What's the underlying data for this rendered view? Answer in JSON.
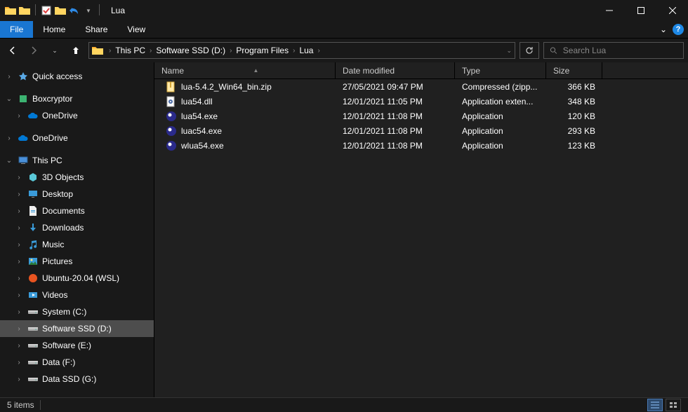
{
  "window": {
    "title": "Lua"
  },
  "ribbon": {
    "file": "File",
    "home": "Home",
    "share": "Share",
    "view": "View"
  },
  "breadcrumb": {
    "items": [
      "This PC",
      "Software SSD (D:)",
      "Program Files",
      "Lua"
    ]
  },
  "search": {
    "placeholder": "Search Lua"
  },
  "columns": {
    "name": "Name",
    "date": "Date modified",
    "type": "Type",
    "size": "Size"
  },
  "files": [
    {
      "name": "lua-5.4.2_Win64_bin.zip",
      "date": "27/05/2021 09:47 PM",
      "type": "Compressed (zipp...",
      "size": "366 KB",
      "icon": "zip"
    },
    {
      "name": "lua54.dll",
      "date": "12/01/2021 11:05 PM",
      "type": "Application exten...",
      "size": "348 KB",
      "icon": "dll"
    },
    {
      "name": "lua54.exe",
      "date": "12/01/2021 11:08 PM",
      "type": "Application",
      "size": "120 KB",
      "icon": "exe"
    },
    {
      "name": "luac54.exe",
      "date": "12/01/2021 11:08 PM",
      "type": "Application",
      "size": "293 KB",
      "icon": "exe"
    },
    {
      "name": "wlua54.exe",
      "date": "12/01/2021 11:08 PM",
      "type": "Application",
      "size": "123 KB",
      "icon": "exe"
    }
  ],
  "sidebar": {
    "quick_access": "Quick access",
    "boxcryptor": "Boxcryptor",
    "onedrive_nested": "OneDrive",
    "onedrive": "OneDrive",
    "this_pc": "This PC",
    "items": [
      {
        "label": "3D Objects",
        "icon": "3d"
      },
      {
        "label": "Desktop",
        "icon": "desktop"
      },
      {
        "label": "Documents",
        "icon": "documents"
      },
      {
        "label": "Downloads",
        "icon": "downloads"
      },
      {
        "label": "Music",
        "icon": "music"
      },
      {
        "label": "Pictures",
        "icon": "pictures"
      },
      {
        "label": "Ubuntu-20.04 (WSL)",
        "icon": "linux"
      },
      {
        "label": "Videos",
        "icon": "videos"
      },
      {
        "label": "System (C:)",
        "icon": "drive"
      },
      {
        "label": "Software SSD (D:)",
        "icon": "drive",
        "selected": true
      },
      {
        "label": "Software (E:)",
        "icon": "drive"
      },
      {
        "label": "Data (F:)",
        "icon": "drive"
      },
      {
        "label": "Data SSD (G:)",
        "icon": "drive"
      }
    ]
  },
  "status": {
    "item_count": "5 items"
  }
}
